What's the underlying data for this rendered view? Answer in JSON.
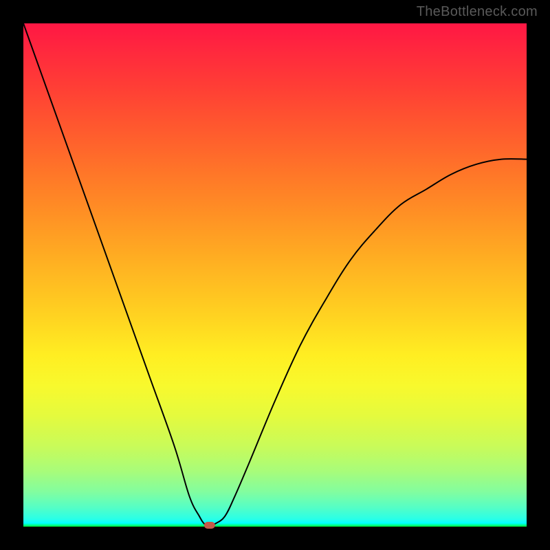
{
  "watermark": "TheBottleneck.com",
  "chart_data": {
    "type": "line",
    "title": "",
    "xlabel": "",
    "ylabel": "",
    "xlim": [
      0,
      100
    ],
    "ylim": [
      0,
      100
    ],
    "series": [
      {
        "name": "bottleneck-curve",
        "x": [
          0,
          5,
          10,
          15,
          20,
          25,
          30,
          33,
          35,
          36,
          37,
          38,
          40,
          42,
          45,
          50,
          55,
          60,
          65,
          70,
          75,
          80,
          85,
          90,
          95,
          100
        ],
        "y": [
          100,
          86,
          72,
          58,
          44,
          30,
          16,
          6,
          2,
          0.5,
          0,
          0.5,
          2,
          6,
          13,
          25,
          36,
          45,
          53,
          59,
          64,
          67,
          70,
          72,
          73,
          73
        ]
      }
    ],
    "marker": {
      "x": 37,
      "y": 0
    },
    "colors": {
      "curve": "#000000",
      "marker": "#c45a4a",
      "gradient_top": "#ff1744",
      "gradient_bottom": "#00ff33"
    }
  }
}
